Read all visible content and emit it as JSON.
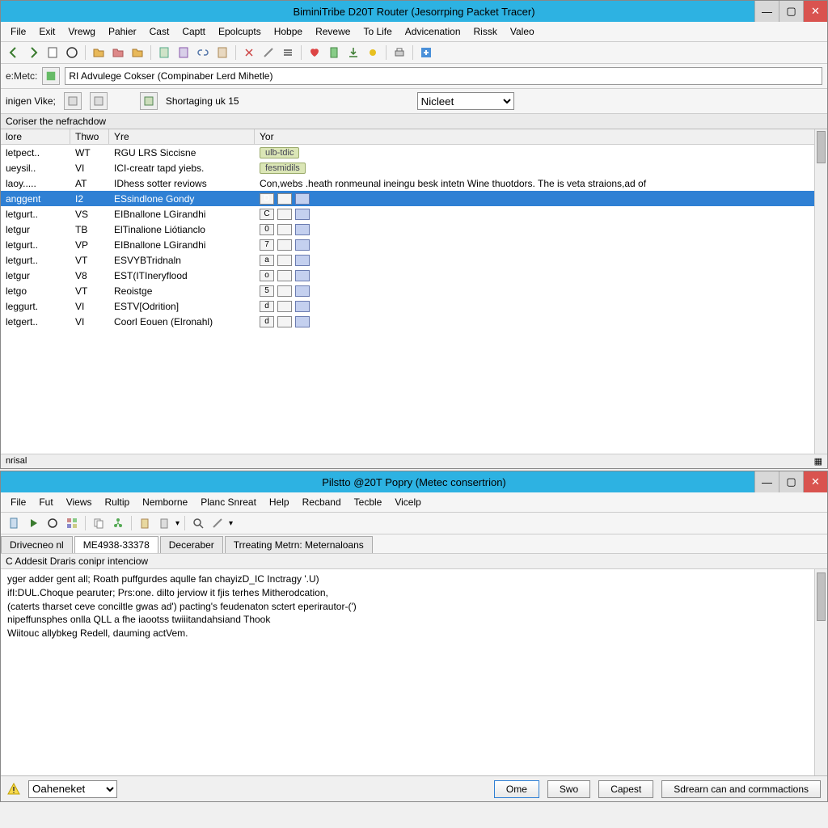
{
  "top_window": {
    "title": "BiminiTribe D20T Router (Jesorrping Packet Tracer)",
    "menu": [
      "File",
      "Exit",
      "Vrewg",
      "Pahier",
      "Cast",
      "Captt",
      "Epolcupts",
      "Hobpe",
      "Revewe",
      "To Life",
      "Advicenation",
      "Rissk",
      "Valeo"
    ],
    "addr_label": "e:Metc:",
    "addr_value": "RI Advulege Cokser (Compinaber Lerd Mihetle)",
    "row2_label": "inigen Vike;",
    "shortaging": "Shortaging uk 15",
    "dropdown_value": "Nicleet",
    "pane_header": "Coriser the nefrachdow",
    "columns": [
      "lore",
      "Thwo",
      "Yre",
      "Yor"
    ],
    "rows": [
      {
        "c0": "letpect..",
        "c1": "WT",
        "c2": "RGU LRS Siccisne",
        "c3_chip": "ulb-tdic",
        "sel": false
      },
      {
        "c0": "ueysil..",
        "c1": "VI",
        "c2": "ICI-creatr tapd yiebs.",
        "c3_chip": "fesmidils",
        "sel": false
      },
      {
        "c0": "laoy.....",
        "c1": "AT",
        "c2": "IDhess sotter reviows",
        "c3_text": "Con,webs .heath ronmeunal ineingu besk intetn Wine thuotdors. The is veta straions,ad of",
        "sel": false
      },
      {
        "c0": "anggent",
        "c1": "I2",
        "c2": "ESsindlone Gondy",
        "c3_box": "D",
        "sel": true
      },
      {
        "c0": "letgurt..",
        "c1": "VS",
        "c2": "EIBnallone LGirandhi",
        "c3_box": "C",
        "sel": false
      },
      {
        "c0": "letgur",
        "c1": "TB",
        "c2": "ElTinalione Liótianclo",
        "c3_box": "0",
        "sel": false
      },
      {
        "c0": "letgurt..",
        "c1": "VP",
        "c2": "EIBnallone LGirandhi",
        "c3_box": "7",
        "sel": false
      },
      {
        "c0": "letgurt..",
        "c1": "VT",
        "c2": "ESVYBTridnaln",
        "c3_box": "a",
        "sel": false
      },
      {
        "c0": "letgur",
        "c1": "V8",
        "c2": "EST(ITIneryflood",
        "c3_box": "o",
        "sel": false
      },
      {
        "c0": "letgo",
        "c1": "VT",
        "c2": "Reoistge",
        "c3_box": "5",
        "sel": false
      },
      {
        "c0": "leggurt.",
        "c1": "VI",
        "c2": "ESTV[Odrition]",
        "c3_box": "d",
        "sel": false
      },
      {
        "c0": "letgert..",
        "c1": "VI",
        "c2": "Coorl Eouen (Elronahl)",
        "c3_box": "d",
        "sel": false
      }
    ],
    "status_left": "nrisal"
  },
  "bottom_window": {
    "title": "Pilstto @20T Popry (Metec consertrion)",
    "menu": [
      "File",
      "Fut",
      "Views",
      "Rultip",
      "Nemborne",
      "Planc Snreat",
      "Help",
      "Recband",
      "Tecble",
      "Vicelp"
    ],
    "tabs": [
      "Drivecneo nl",
      "ME4938-33378",
      "Deceraber",
      "Trreating Metrn: Meternaloans"
    ],
    "active_tab": 1,
    "subheader": "C Addesit Draris conipr intenciow",
    "log_lines": [
      "yger adder gent all; Roath puffgurdes aqulle fan chayizD_IC Inctragy '.U)",
      "ifI:DUL.Choque pearuter; Prs:one. dilto jerviow it fjis terhes Mitherodcation,",
      "(caterts tharset ceve conciltle gwas ad') pacting's feudenaton sctert eperirautor-(')",
      "nipeffunsphes onlla QLL a fhe iaootss twiiitandahsiand Thook",
      "Wiitouc allybkeg Redell, dauming actVem."
    ]
  },
  "bottombar": {
    "combo_value": "Oaheneket",
    "btn_ome": "Ome",
    "btn_swo": "Swo",
    "btn_capest": "Capest",
    "btn_long": "Sdrearn can and cormmactions"
  }
}
